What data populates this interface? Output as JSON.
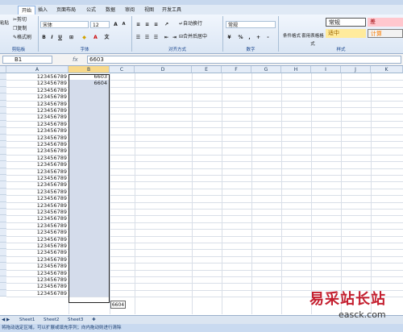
{
  "ribbon": {
    "tabs": [
      "开始",
      "插入",
      "页面布局",
      "公式",
      "数据",
      "审阅",
      "视图",
      "开发工具"
    ],
    "clipboard": {
      "paste": "粘贴",
      "cut": "剪切",
      "copy": "复制",
      "format_painter": "格式刷",
      "label": "剪贴板"
    },
    "font": {
      "name": "宋体",
      "size": "12",
      "label": "字体"
    },
    "alignment": {
      "wrap": "自动换行",
      "merge": "合并后居中",
      "label": "对齐方式"
    },
    "number": {
      "format": "常规",
      "label": "数字"
    },
    "styles": {
      "conditional": "条件格式",
      "table": "套用表格格式",
      "normal": "常规",
      "bad": "差",
      "neutral": "适中",
      "calc": "计算",
      "label": "样式"
    }
  },
  "formula_bar": {
    "name_box": "B1",
    "fx": "fx",
    "value": "6603"
  },
  "columns": [
    "A",
    "B",
    "C",
    "D",
    "E",
    "F",
    "G",
    "H",
    "I",
    "J",
    "K"
  ],
  "rows": {
    "a_values": [
      "123456789",
      "123456789",
      "123456789",
      "123456789",
      "123456789",
      "123456789",
      "123456789",
      "123456789",
      "123456789",
      "123456789",
      "123456789",
      "123456789",
      "123456789",
      "123456789",
      "123456789",
      "123456789",
      "123456789",
      "123456789",
      "123456789",
      "123456789",
      "123456789",
      "123456789",
      "123456789",
      "123456789",
      "123456789",
      "123456789",
      "123456789",
      "123456789",
      "123456789",
      "123456789",
      "123456789",
      "123456789",
      "123456789"
    ],
    "b_values": [
      "6603",
      "6604"
    ]
  },
  "fill_tooltip": "6604",
  "sheet_tabs": [
    "Sheet1",
    "Sheet2",
    "Sheet3"
  ],
  "status_text": "将拖动选定区域，可以扩展或填充序列；向内拖动则进行清除",
  "watermark": {
    "brand": "易采站长站",
    "url": "easck.com"
  }
}
